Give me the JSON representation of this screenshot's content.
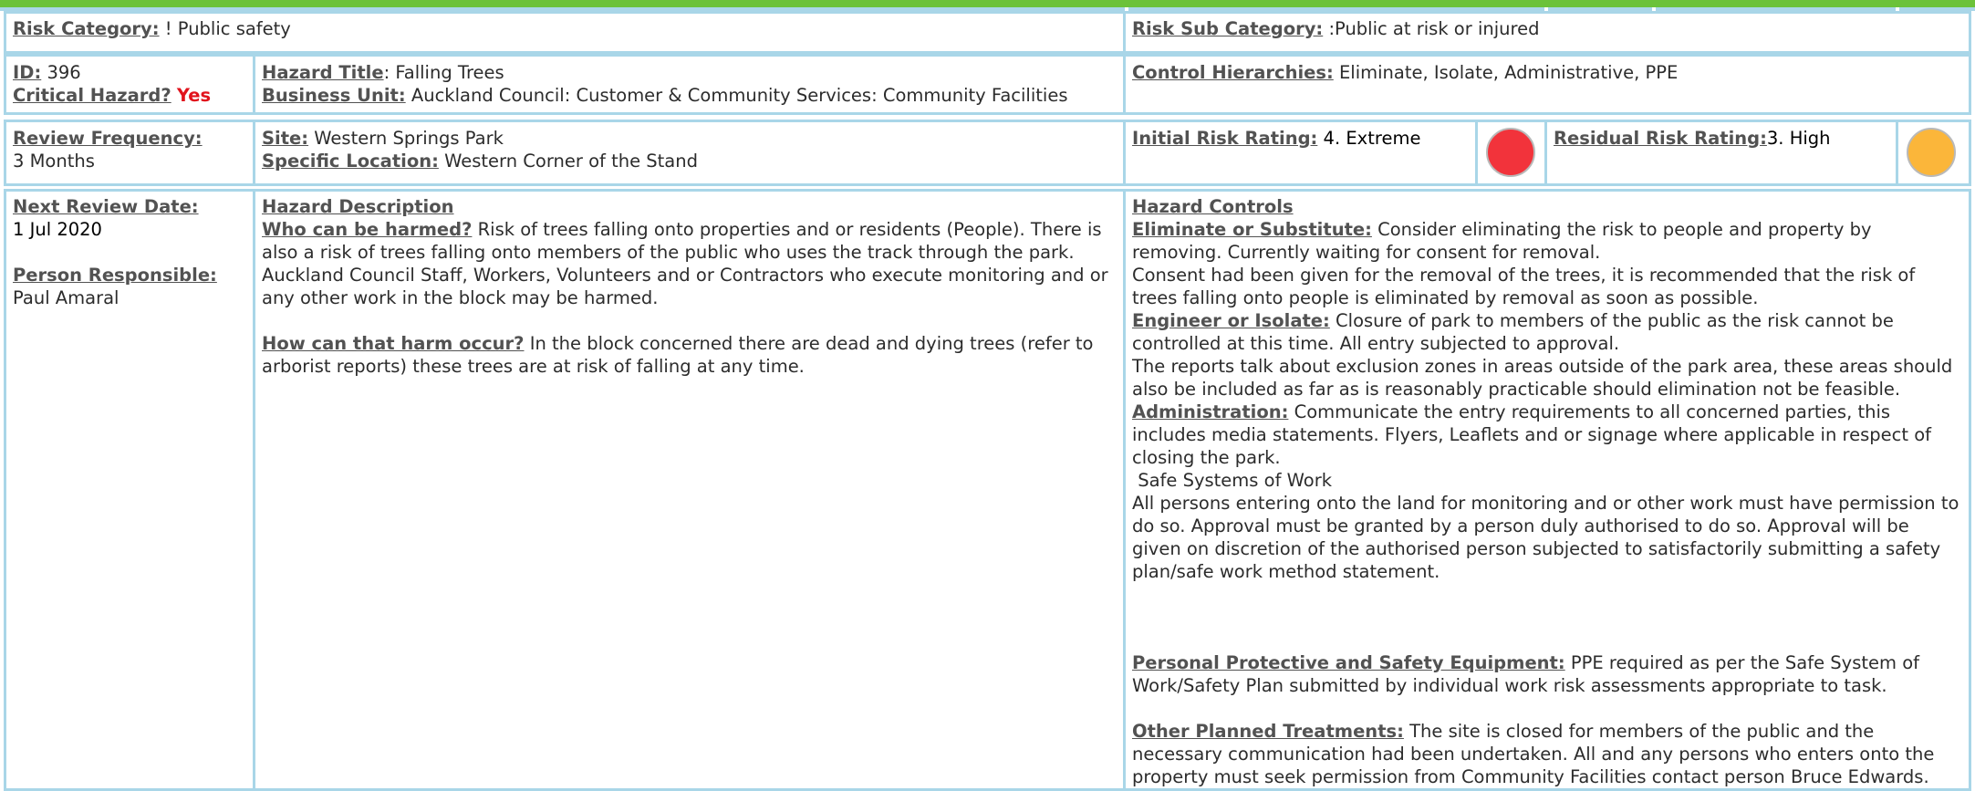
{
  "header": {
    "risk_category_label": "Risk Category:",
    "risk_category_value": "! Public safety",
    "risk_sub_category_label": "Risk Sub Category:",
    "risk_sub_category_value": ":Public at risk or injured"
  },
  "row2": {
    "id_label": "ID:",
    "id_value": "396",
    "critical_label": "Critical Hazard?",
    "critical_value": "Yes",
    "hazard_title_label": "Hazard Title",
    "hazard_title_value": ": Falling Trees",
    "business_unit_label": "Business Unit:",
    "business_unit_value": "Auckland Council: Customer & Community Services: Community Facilities",
    "control_hierarchies_label": "Control Hierarchies:",
    "control_hierarchies_value": "Eliminate, Isolate, Administrative, PPE"
  },
  "row3": {
    "review_frequency_label": "Review Frequency:",
    "review_frequency_value": "3 Months",
    "site_label": "Site:",
    "site_value": "Western Springs Park",
    "specific_location_label": "Specific Location:",
    "specific_location_value": "Western Corner of the Stand",
    "initial_risk_label": "Initial Risk Rating:",
    "initial_risk_value": "4. Extreme",
    "initial_risk_color": "#f2333b",
    "residual_risk_label": "Residual Risk Rating:",
    "residual_risk_value": "3. High",
    "residual_risk_color": "#fbb63a"
  },
  "row4": {
    "next_review_label": "Next Review Date:",
    "next_review_value": "1 Jul 2020",
    "person_label": "Person Responsible:",
    "person_value": "Paul Amaral",
    "hazard_description_heading": "Hazard Description",
    "who_label": "Who can be harmed?",
    "who_text": "Risk of trees falling onto properties and or residents (People). There is also a risk of trees falling onto members of the public who uses the track through the park. Auckland Council Staff, Workers, Volunteers and or Contractors who execute monitoring and or any other work in the block may be harmed.",
    "how_label": "How can that harm occur?",
    "how_text": "In the block concerned there are dead and dying trees (refer to arborist reports) these trees are at risk of falling at any time.",
    "hazard_controls_heading": "Hazard Controls",
    "eliminate_label": "Eliminate or Substitute:",
    "eliminate_text": "Consider eliminating the risk to people and property by removing. Currently waiting for consent for removal.",
    "eliminate_text2": "Consent had been given for the removal of the trees, it is recommended that the risk of trees falling onto people is eliminated by removal as soon as possible.",
    "engineer_label": "Engineer or Isolate:",
    "engineer_text": "Closure of park to members of the public as the risk cannot be controlled at this time. All entry subjected to approval.",
    "engineer_text2": "The reports talk about exclusion zones in areas outside of the park area, these areas should also be included as far as is reasonably practicable should elimination not be feasible.",
    "administration_label": "Administration:",
    "administration_text": "Communicate the entry requirements  to all concerned parties, this includes media statements. Flyers, Leaflets and or signage where applicable in respect of closing the park.",
    "safe_systems": " Safe Systems of Work",
    "administration_text2": "All persons entering onto the land for monitoring and or other work must have permission to do so. Approval must be granted by a person duly authorised to do so. Approval will be given on discretion of the authorised person subjected to satisfactorily submitting a safety plan/safe work method statement.",
    "ppe_label": "Personal Protective and Safety Equipment:",
    "ppe_text": "PPE required as per the Safe System of Work/Safety Plan submitted by individual work risk assessments appropriate to task.",
    "other_label": "Other Planned Treatments:",
    "other_text": " The site is closed for members of the public and the necessary communication had been undertaken. All and any persons who enters onto the property must seek permission from Community Facilities  contact person Bruce Edwards. Entry subjected an approved Safe Work Method Statement."
  }
}
